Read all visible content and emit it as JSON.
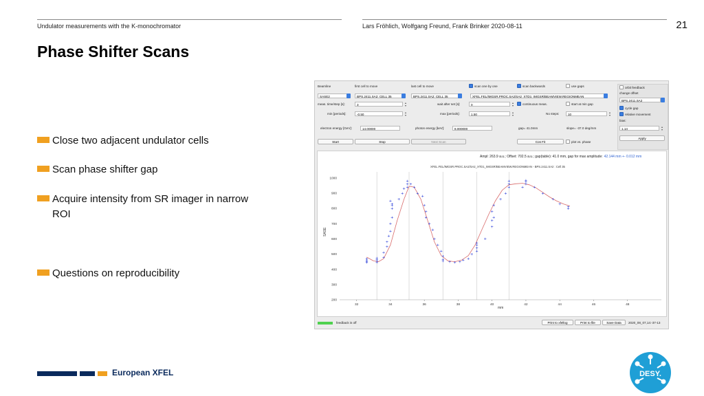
{
  "header": {
    "left": "Undulator measurements with the K-monochromator",
    "center": "Lars Fröhlich, Wolfgang Freund, Frank Brinker 2020-08-11",
    "page_number": "21"
  },
  "title": "Phase Shifter Scans",
  "bullets": [
    {
      "line1": "Close two adjacent undulator cells",
      "line2": ""
    },
    {
      "line1": "Scan phase shifter gap",
      "line2": ""
    },
    {
      "line1": "Acquire intensity from SR imager in narrow",
      "line2": "ROI"
    },
    {
      "line1": "Questions on reproducibility",
      "line2": ""
    }
  ],
  "footer": {
    "brand": "European XFEL",
    "logo_text": "DESY."
  },
  "colors": {
    "accent": "#f0a020",
    "navy": "#0a2a5c",
    "desy_blue": "#1f9fd6",
    "fit": "#d86a6a",
    "points": "#1a2fd6"
  },
  "app": {
    "labels": {
      "beamline": "Beamline",
      "first_cell": "first cell to move",
      "last_cell": "last cell to move",
      "scan_one_by_one": "scan one by one",
      "scan_backwards": "scan backwards",
      "use_gaps": "use gaps",
      "orbit_feedback": "orbit feedback",
      "change_offset": "change offset",
      "meas_time": "meas. time/step [s]:",
      "wait_after_set": "wait after set [s]:",
      "continuous": "continuous meas.",
      "start_min_gap": "start at min gap",
      "min_periods": "min [periods]:",
      "max_periods": "max [periods]:",
      "no_steps": "No steps:",
      "cycle_gap": "cycle gap",
      "relative_movement": "relative movement",
      "bias": "bias:",
      "electron_energy": "electron energy [GeV]:",
      "photon_energy": "photon energy [keV]:",
      "gap_readout": "gap= 41.0mm",
      "slope_readout": "slope= -37.0 deg/mm",
      "plot_vs_phase": "plot vs. phase",
      "feedback_off": "feedback is off"
    },
    "values": {
      "beamline": "SASE2",
      "first_cell": "BPS.2411.SA2: CELL 35",
      "last_cell": "BPS.2411.SA2: CELL 35",
      "signal": "XFEL.FEL/IMGSR.PROC.SA2/SA2_XTD1_IMGSR/BEAMVIEW.REGIONMEAN",
      "meas_time": "3",
      "wait_after_set": "0",
      "min_periods": "-0.50",
      "max_periods": "1.50",
      "no_steps": "10",
      "offset_select": "BPS.2411.SA2",
      "electron_energy": "14.00000",
      "photon_energy": "8.000000",
      "bias_value": "1.14"
    },
    "checks": {
      "scan_one_by_one": true,
      "scan_backwards": true,
      "use_gaps": false,
      "orbit_feedback": false,
      "continuous": true,
      "start_min_gap": false,
      "cycle_gap": true,
      "relative_movement": true,
      "plot_vs_phase": false
    },
    "buttons": {
      "start": "Start",
      "stop": "Stop",
      "next_scan": "Next Scan",
      "cos_fit": "Cos Fit",
      "apply": "Apply",
      "print_elog": "Print to xfellog",
      "print_file": "Print to file",
      "save_data": "Save Data",
      "timestamp": "2020_08_07,14:-37-13"
    },
    "plot": {
      "fit_result": "Ampl: 263.9 a.u.; Offset: 702.5 a.u.; gap(table): 41.0 mm, gap for max amplitude:",
      "fit_highlight": "42.144 mm +- 0.012 mm",
      "title": "XFEL.FEL/IMGSR.PROC.SA2/SA2_XTD1_IMGSR/BEAMVIEW.REGIONMEAN - BPS.2411.SA2 : Cell 35",
      "ylabel": "SASE",
      "xlabel": "mm"
    }
  },
  "chart_data": {
    "type": "scatter",
    "title": "XFEL.FEL/IMGSR.PROC.SA2/SA2_XTD1_IMGSR/BEAMVIEW.REGIONMEAN - BPS.2411.SA2 : Cell 35",
    "xlabel": "mm",
    "ylabel": "SASE",
    "xlim": [
      31,
      50
    ],
    "ylim": [
      200,
      1040
    ],
    "xticks": [
      32,
      34,
      36,
      38,
      40,
      42,
      44,
      46,
      48
    ],
    "yticks": [
      200,
      300,
      400,
      500,
      600,
      700,
      800,
      900,
      1000
    ],
    "vlines": [
      33.2,
      35.1,
      37.1,
      39.1,
      41.0
    ],
    "series": [
      {
        "points": [
          [
            32.6,
            450
          ],
          [
            32.6,
            460
          ],
          [
            32.6,
            470
          ],
          [
            32.6,
            445
          ],
          [
            33.2,
            455
          ],
          [
            33.2,
            465
          ],
          [
            33.2,
            445
          ],
          [
            33.2,
            475
          ],
          [
            33.6,
            480
          ],
          [
            33.6,
            510
          ],
          [
            33.8,
            550
          ],
          [
            33.8,
            580
          ],
          [
            33.9,
            620
          ],
          [
            34.0,
            650
          ],
          [
            34.0,
            700
          ],
          [
            34.1,
            740
          ],
          [
            34.1,
            800
          ],
          [
            34.1,
            820
          ],
          [
            34.1,
            830
          ],
          [
            34.0,
            850
          ],
          [
            34.5,
            860
          ],
          [
            34.7,
            900
          ],
          [
            34.8,
            930
          ],
          [
            35.0,
            960
          ],
          [
            35.0,
            940
          ],
          [
            35.0,
            980
          ],
          [
            35.2,
            960
          ],
          [
            35.4,
            940
          ],
          [
            35.6,
            900
          ],
          [
            35.9,
            880
          ],
          [
            36.0,
            820
          ],
          [
            36.1,
            780
          ],
          [
            36.1,
            740
          ],
          [
            36.3,
            700
          ],
          [
            36.5,
            660
          ],
          [
            36.6,
            600
          ],
          [
            36.8,
            560
          ],
          [
            37.0,
            520
          ],
          [
            37.1,
            485
          ],
          [
            37.1,
            465
          ],
          [
            37.1,
            455
          ],
          [
            37.5,
            450
          ],
          [
            37.8,
            445
          ],
          [
            38.1,
            450
          ],
          [
            38.3,
            460
          ],
          [
            38.6,
            470
          ],
          [
            38.8,
            500
          ],
          [
            39.1,
            520
          ],
          [
            39.1,
            540
          ],
          [
            39.1,
            560
          ],
          [
            39.1,
            575
          ],
          [
            39.6,
            600
          ],
          [
            40.0,
            680
          ],
          [
            40.0,
            720
          ],
          [
            40.1,
            740
          ],
          [
            40.0,
            780
          ],
          [
            40.1,
            820
          ],
          [
            40.5,
            860
          ],
          [
            40.8,
            900
          ],
          [
            41.0,
            940
          ],
          [
            41.0,
            960
          ],
          [
            41.0,
            980
          ],
          [
            41.8,
            940
          ],
          [
            42.0,
            960
          ],
          [
            42.0,
            975
          ],
          [
            42.0,
            985
          ],
          [
            42.5,
            940
          ],
          [
            43.0,
            900
          ],
          [
            43.6,
            860
          ],
          [
            44.0,
            830
          ],
          [
            44.5,
            810
          ],
          [
            44.5,
            800
          ]
        ]
      },
      {
        "name": "fit",
        "x": [
          32.6,
          33.0,
          33.3,
          33.6,
          34.0,
          34.4,
          34.8,
          35.1,
          35.4,
          35.8,
          36.2,
          36.6,
          37.0,
          37.4,
          37.8,
          38.2,
          38.6,
          39.0,
          39.4,
          39.8,
          40.2,
          40.6,
          41.0,
          41.4,
          41.8,
          42.2,
          42.6,
          43.0,
          43.4,
          43.8,
          44.2,
          44.6
        ],
        "y": [
          480,
          455,
          450,
          470,
          560,
          720,
          860,
          945,
          940,
          860,
          720,
          580,
          490,
          455,
          450,
          460,
          490,
          560,
          660,
          760,
          850,
          920,
          955,
          962,
          965,
          955,
          935,
          905,
          875,
          850,
          830,
          815
        ]
      }
    ]
  }
}
